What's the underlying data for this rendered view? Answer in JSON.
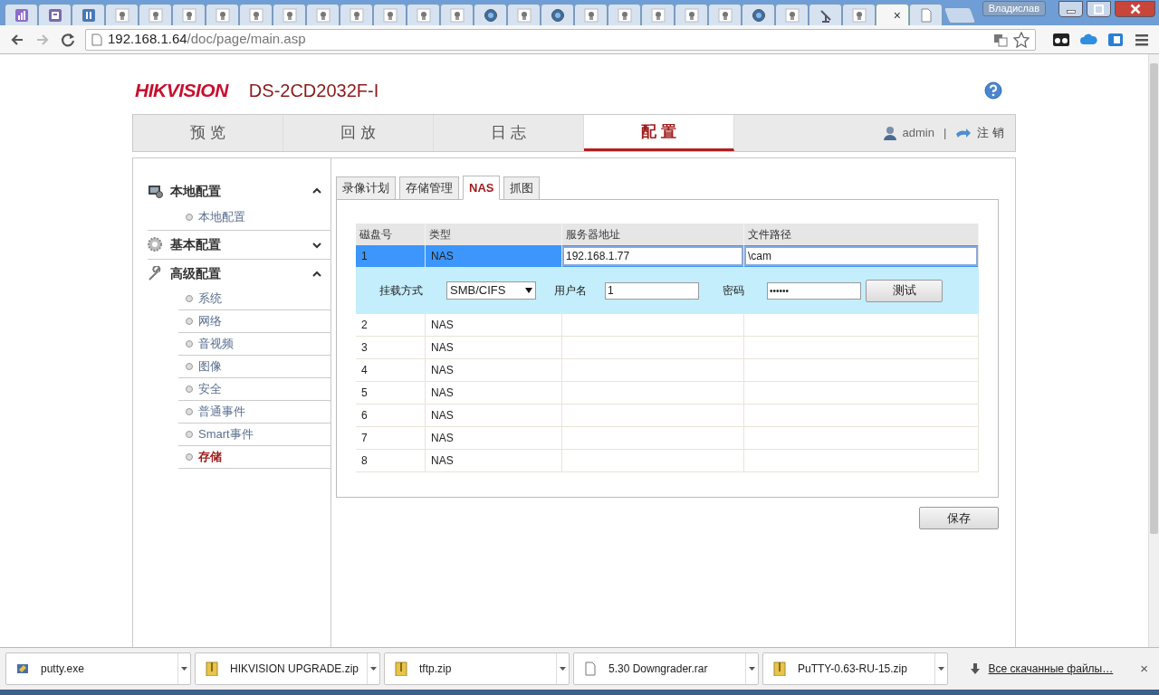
{
  "browser": {
    "tabs": [
      {
        "kind": "chart",
        "selected": false
      },
      {
        "kind": "form",
        "selected": false
      },
      {
        "kind": "pause",
        "selected": false
      },
      {
        "kind": "camera",
        "selected": false
      },
      {
        "kind": "camera",
        "selected": false
      },
      {
        "kind": "camera",
        "selected": false
      },
      {
        "kind": "camera",
        "selected": false
      },
      {
        "kind": "camera",
        "selected": false
      },
      {
        "kind": "camera",
        "selected": false
      },
      {
        "kind": "camera",
        "selected": false
      },
      {
        "kind": "camera",
        "selected": false
      },
      {
        "kind": "camera",
        "selected": false
      },
      {
        "kind": "camera",
        "selected": false
      },
      {
        "kind": "camera",
        "selected": false
      },
      {
        "kind": "globe",
        "selected": false
      },
      {
        "kind": "camera",
        "selected": false
      },
      {
        "kind": "globe",
        "selected": false
      },
      {
        "kind": "camera",
        "selected": false
      },
      {
        "kind": "camera",
        "selected": false
      },
      {
        "kind": "camera",
        "selected": false
      },
      {
        "kind": "camera",
        "selected": false
      },
      {
        "kind": "camera",
        "selected": false
      },
      {
        "kind": "globe",
        "selected": false
      },
      {
        "kind": "camera",
        "selected": false
      },
      {
        "kind": "antenna",
        "selected": false
      },
      {
        "kind": "camera",
        "selected": false
      },
      {
        "kind": "blank",
        "selected": true,
        "close": "×"
      },
      {
        "kind": "page",
        "selected": false
      }
    ],
    "profile": "Владислав",
    "url_host": "192.168.1.64",
    "url_path": "/doc/page/main.asp"
  },
  "header": {
    "brand": "HIKVISION",
    "model": "DS-2CD2032F-I"
  },
  "nav": {
    "tabs": [
      {
        "label": "预 览",
        "selected": false
      },
      {
        "label": "回 放",
        "selected": false
      },
      {
        "label": "日 志",
        "selected": false
      },
      {
        "label": "配 置",
        "selected": true
      }
    ],
    "user": "admin",
    "separator": "|",
    "logout": "注 销"
  },
  "sidebar": {
    "groups": [
      {
        "label": "本地配置",
        "kind": "monitor",
        "expanded": true,
        "children": [
          {
            "label": "本地配置",
            "selected": false
          }
        ]
      },
      {
        "label": "基本配置",
        "kind": "gear",
        "expanded": false
      },
      {
        "label": "高级配置",
        "kind": "wrench",
        "expanded": true,
        "children": [
          {
            "label": "系统",
            "selected": false
          },
          {
            "label": "网络",
            "selected": false
          },
          {
            "label": "音视频",
            "selected": false
          },
          {
            "label": "图像",
            "selected": false
          },
          {
            "label": "安全",
            "selected": false
          },
          {
            "label": "普通事件",
            "selected": false
          },
          {
            "label": "Smart事件",
            "selected": false
          },
          {
            "label": "存储",
            "selected": true
          }
        ]
      }
    ]
  },
  "subtabs": [
    {
      "label": "录像计划",
      "selected": false
    },
    {
      "label": "存储管理",
      "selected": false
    },
    {
      "label": "NAS",
      "selected": true
    },
    {
      "label": "抓图",
      "selected": false
    }
  ],
  "nas_table": {
    "columns": [
      "磁盘号",
      "类型",
      "服务器地址",
      "文件路径"
    ],
    "rows": [
      {
        "disk": "1",
        "type": "NAS",
        "server": "192.168.1.77",
        "path": "\\cam",
        "selected": true,
        "details": {
          "mount_label": "挂载方式",
          "mount_value": "SMB/CIFS",
          "user_label": "用户名",
          "user_value": "1",
          "password_label": "密码",
          "password_value": "••••••",
          "test_button": "测试"
        }
      },
      {
        "disk": "2",
        "type": "NAS",
        "selected": false
      },
      {
        "disk": "3",
        "type": "NAS",
        "selected": false
      },
      {
        "disk": "4",
        "type": "NAS",
        "selected": false
      },
      {
        "disk": "5",
        "type": "NAS",
        "selected": false
      },
      {
        "disk": "6",
        "type": "NAS",
        "selected": false
      },
      {
        "disk": "7",
        "type": "NAS",
        "selected": false
      },
      {
        "disk": "8",
        "type": "NAS",
        "selected": false
      }
    ]
  },
  "save_button": "保存",
  "downloads": {
    "items": [
      {
        "name": "putty.exe",
        "kind": "exe"
      },
      {
        "name": "HIKVISION UPGRADE.zip",
        "kind": "archive"
      },
      {
        "name": "tftp.zip",
        "kind": "archive"
      },
      {
        "name": "5.30 Downgrader.rar",
        "kind": "file"
      },
      {
        "name": "PuTTY-0.63-RU-15.zip",
        "kind": "archive"
      }
    ],
    "show_all": "Все скачанные файлы…",
    "close": "×"
  }
}
